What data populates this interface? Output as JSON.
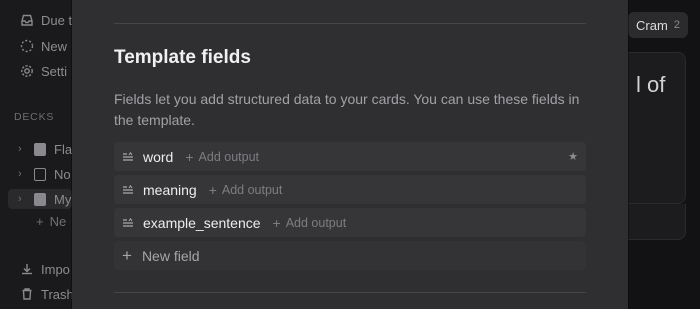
{
  "sidebar": {
    "nav": [
      {
        "label": "Due t",
        "icon": "inbox-icon"
      },
      {
        "label": "New",
        "icon": "dashed-circle-icon"
      },
      {
        "label": "Setti",
        "icon": "gear-icon"
      }
    ],
    "section_label": "DECKS",
    "decks": [
      {
        "label": "Fla",
        "icon": "book-icon"
      },
      {
        "label": "No",
        "icon": "note-icon"
      },
      {
        "label": "My",
        "icon": "book-icon"
      }
    ],
    "new_deck_label": "Ne",
    "footer": [
      {
        "label": "Impo",
        "icon": "download-icon"
      },
      {
        "label": "Trash",
        "icon": "trash-icon"
      }
    ]
  },
  "background": {
    "cram_label": "Cram",
    "cram_count": "2",
    "card_text": "l of"
  },
  "modal": {
    "title": "Template fields",
    "description": "Fields let you add structured data to your cards. You can use these fields in the template.",
    "add_output_label": "Add output",
    "fields": [
      {
        "name": "word",
        "icon": "text-field-icon",
        "starred": true
      },
      {
        "name": "meaning",
        "icon": "text-field-icon",
        "starred": false
      },
      {
        "name": "example_sentence",
        "icon": "text-field-icon",
        "starred": false
      }
    ],
    "new_field_label": "New field"
  }
}
